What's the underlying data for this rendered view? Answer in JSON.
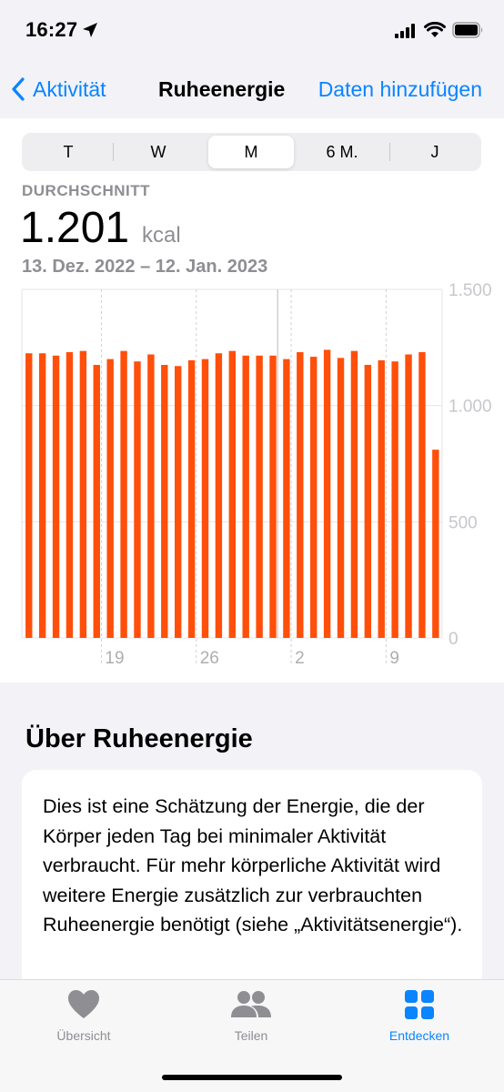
{
  "status_bar": {
    "time": "16:27"
  },
  "nav": {
    "back_label": "Aktivität",
    "title": "Ruheenergie",
    "action_label": "Daten hinzufügen"
  },
  "segments": {
    "items": [
      "T",
      "W",
      "M",
      "6 M.",
      "J"
    ],
    "selected": "M"
  },
  "summary": {
    "label": "DURCHSCHNITT",
    "value": "1.201",
    "unit": "kcal",
    "range": "13. Dez. 2022 – 12. Jan. 2023"
  },
  "chart_data": {
    "type": "bar",
    "color": "#ff4f0a",
    "x": [
      "13",
      "14",
      "15",
      "16",
      "17",
      "18",
      "19",
      "20",
      "21",
      "22",
      "23",
      "24",
      "25",
      "26",
      "27",
      "28",
      "29",
      "30",
      "31",
      "1",
      "2",
      "3",
      "4",
      "5",
      "6",
      "7",
      "8",
      "9",
      "10",
      "11",
      "12"
    ],
    "values": [
      1225,
      1225,
      1215,
      1230,
      1235,
      1175,
      1200,
      1235,
      1190,
      1220,
      1175,
      1170,
      1195,
      1200,
      1225,
      1235,
      1215,
      1215,
      1215,
      1200,
      1230,
      1210,
      1240,
      1205,
      1235,
      1175,
      1195,
      1190,
      1220,
      1230,
      810
    ],
    "ylim": [
      0,
      1500
    ],
    "ytick_labels": [
      "1.500",
      "1.000",
      "500",
      "0"
    ],
    "xtick_labels": [
      "19",
      "26",
      "2",
      "9"
    ],
    "grid": true
  },
  "about": {
    "title": "Über Ruheenergie",
    "text": "Dies ist eine Schätzung der Energie, die der Körper jeden Tag bei minimaler Aktivität verbraucht. Für mehr körperliche Aktivität wird weitere Energie zusätzlich zur verbrauchten Ruheenergie benötigt (siehe „Aktivitätsenergie“)."
  },
  "tabbar": {
    "items": [
      {
        "label": "Übersicht",
        "icon": "heart-icon"
      },
      {
        "label": "Teilen",
        "icon": "people-icon"
      },
      {
        "label": "Entdecken",
        "icon": "grid-icon"
      }
    ],
    "active": "Entdecken"
  },
  "colors": {
    "accent": "#0a84ff",
    "bar": "#ff4f0a",
    "secondary_text": "#8e8e93"
  }
}
